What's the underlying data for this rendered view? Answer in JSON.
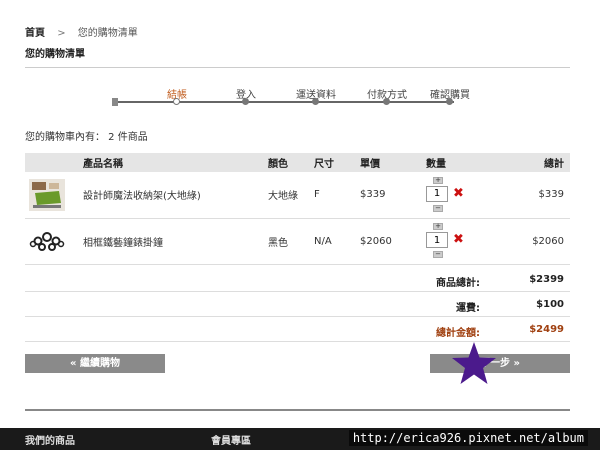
{
  "breadcrumb": {
    "home": "首頁",
    "separator": ">",
    "current": "您的購物清單"
  },
  "page_title": "您的購物清單",
  "steps": [
    {
      "label": "結帳",
      "active": true
    },
    {
      "label": "登入",
      "active": false
    },
    {
      "label": "運送資料",
      "active": false
    },
    {
      "label": "付款方式",
      "active": false
    },
    {
      "label": "確認購買",
      "active": false
    }
  ],
  "cart_count": "您的購物車內有： 2 件商品",
  "table": {
    "headers": {
      "name": "產品名稱",
      "color": "顏色",
      "size": "尺寸",
      "price": "單價",
      "qty": "數量",
      "total": "總計"
    },
    "rows": [
      {
        "name": "設計師魔法收納架(大地綠)",
        "color": "大地綠",
        "size": "F",
        "price": "$339",
        "qty": "1",
        "total": "$339",
        "thumb_icon": "green-shelf-thumbnail"
      },
      {
        "name": "相框鐵藝鐘錶掛鐘",
        "color": "黑色",
        "size": "N/A",
        "price": "$2060",
        "qty": "1",
        "total": "$2060",
        "thumb_icon": "wall-clock-thumbnail"
      }
    ]
  },
  "summary": {
    "subtotal_label": "商品總計:",
    "subtotal": "$2399",
    "shipping_label": "運費:",
    "shipping": "$100",
    "grand_label": "總計金額:",
    "grand": "$2499"
  },
  "buttons": {
    "continue": "« 繼續購物",
    "next": "下一步 »"
  },
  "footer": {
    "left": "我們的商品",
    "middle": "會員專區"
  },
  "watermark": "http://erica926.pixnet.net/album",
  "colors": {
    "accent": "#c05a1a",
    "button": "#8a8a8a",
    "remove": "#cc1111",
    "star": "#4b1a8c"
  }
}
